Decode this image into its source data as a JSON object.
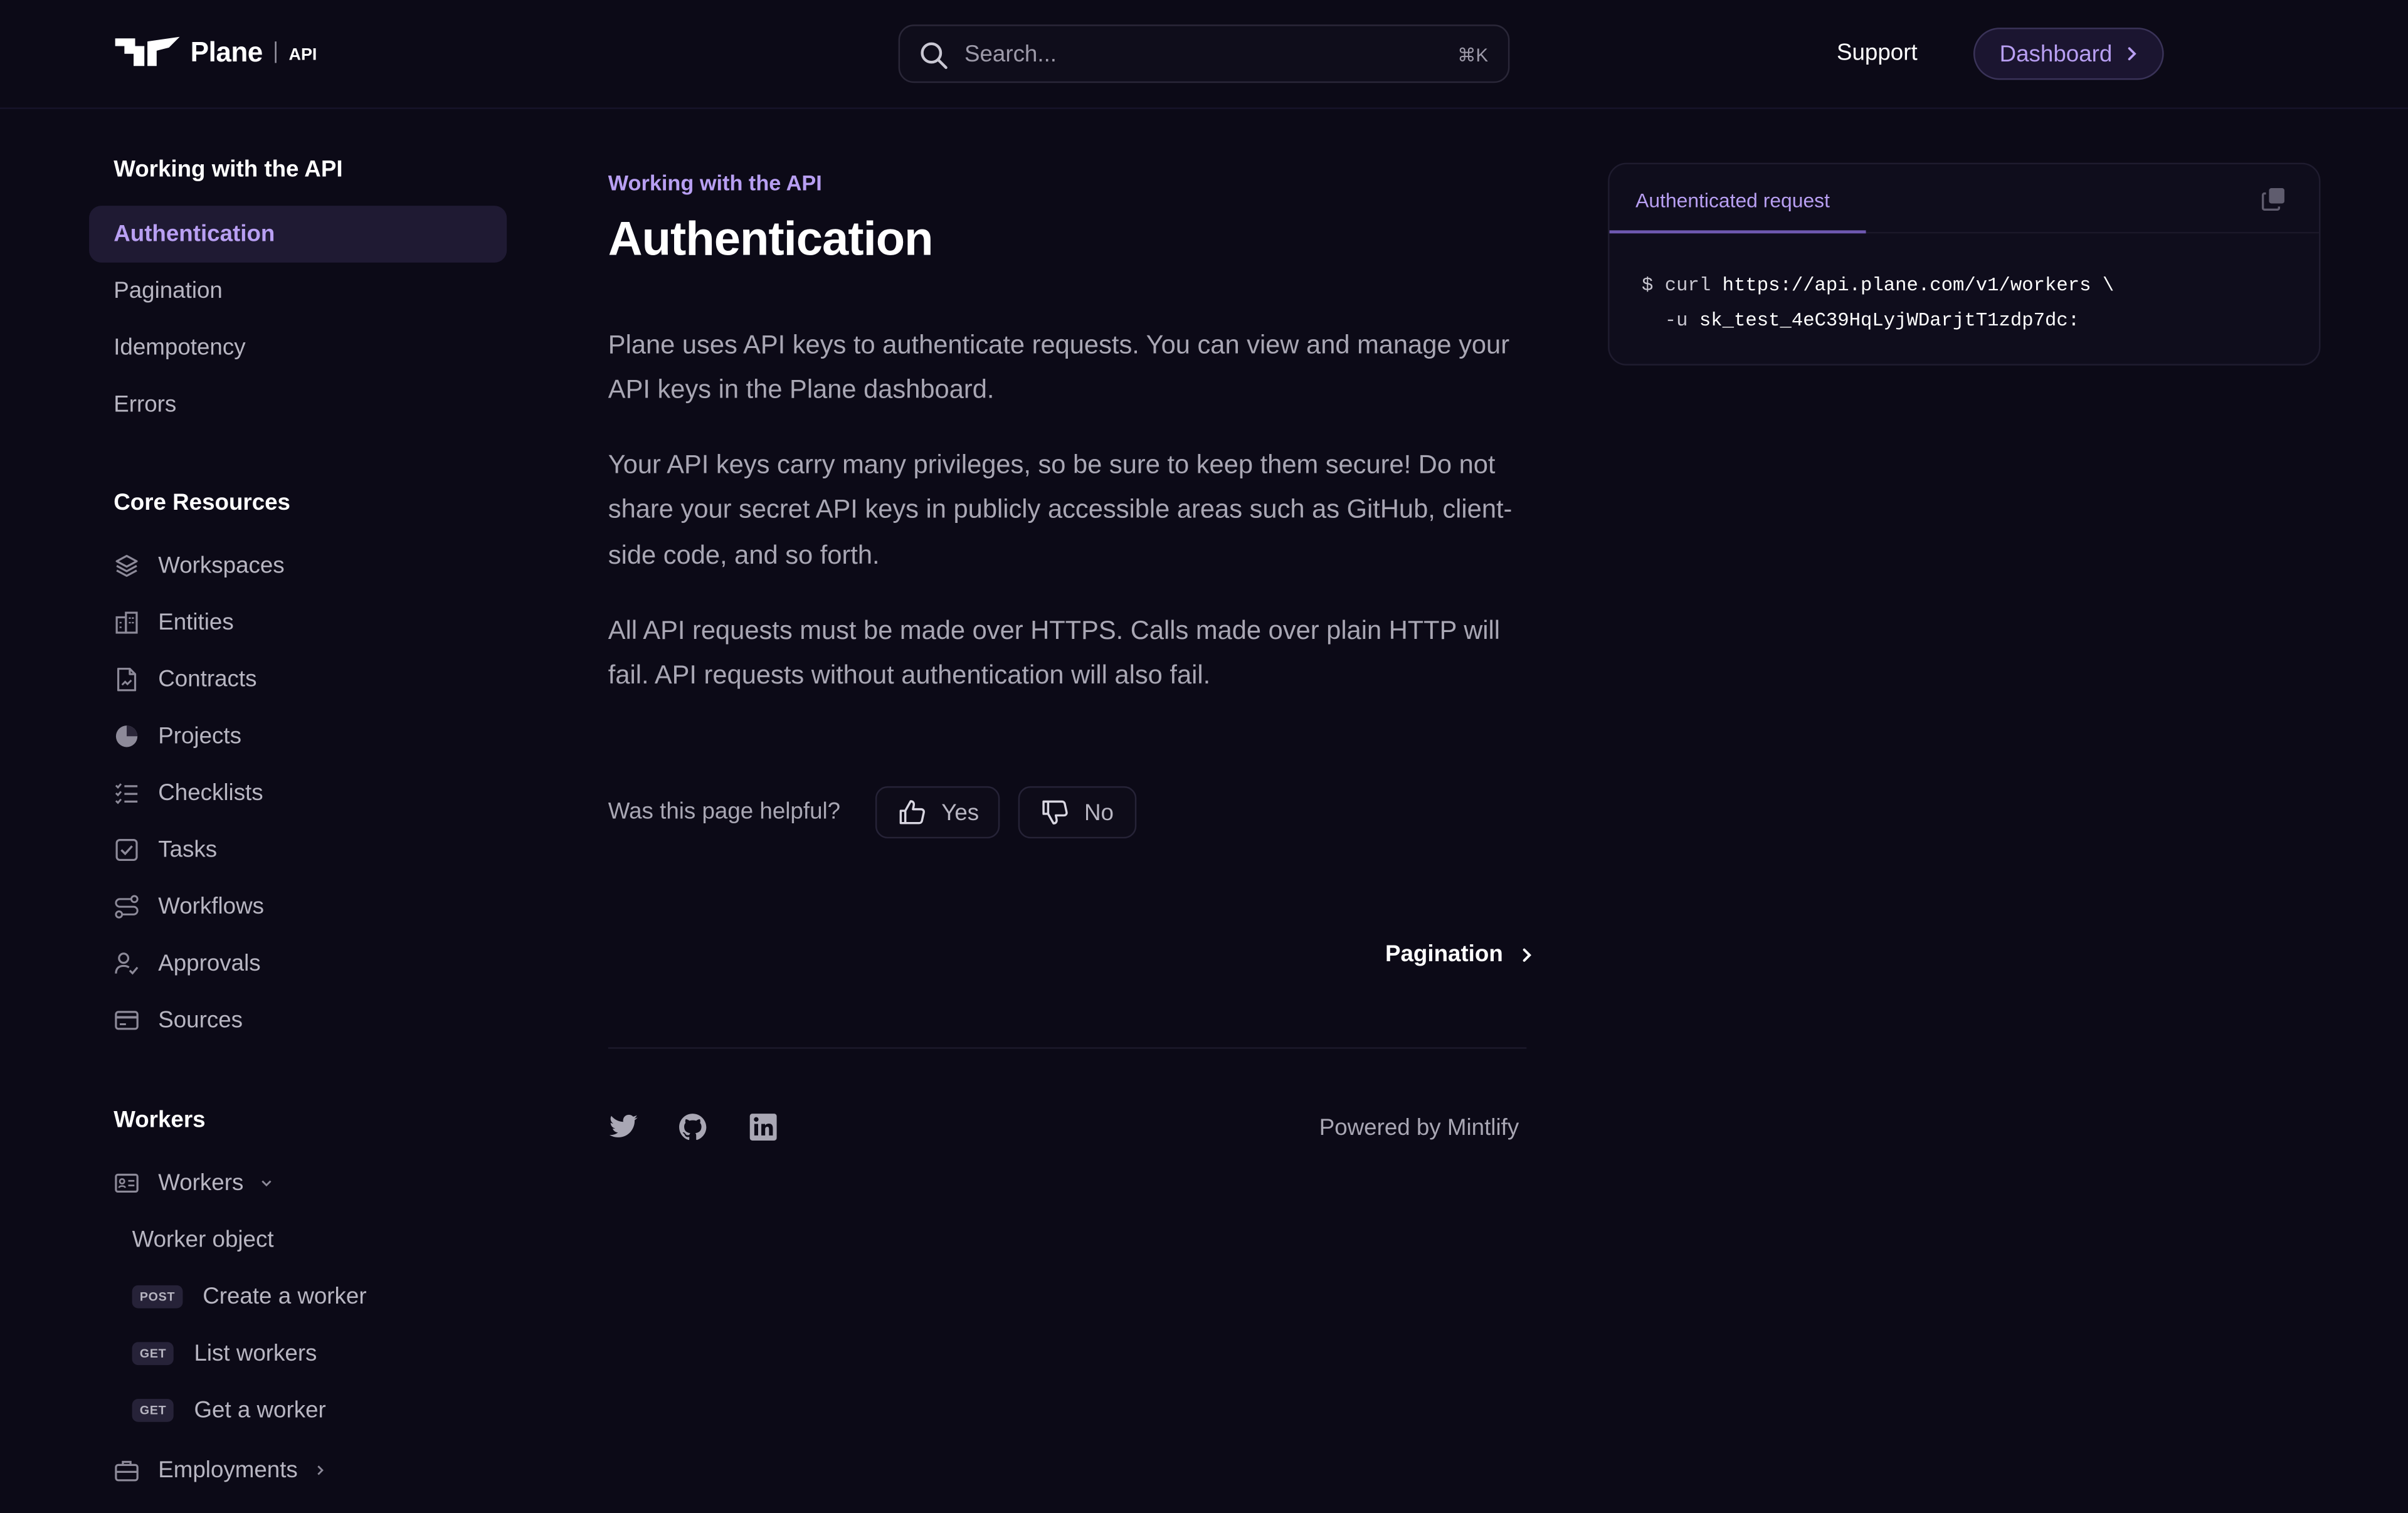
{
  "header": {
    "logo_text": "Plane",
    "logo_sub": "API",
    "search_placeholder": "Search...",
    "search_shortcut": "⌘K",
    "support_label": "Support",
    "dashboard_label": "Dashboard"
  },
  "sidebar": {
    "section1_title": "Working with the API",
    "section1_items": [
      "Authentication",
      "Pagination",
      "Idempotency",
      "Errors"
    ],
    "section2_title": "Core Resources",
    "section2_items": [
      {
        "label": "Workspaces",
        "icon": "layers-icon"
      },
      {
        "label": "Entities",
        "icon": "building-icon"
      },
      {
        "label": "Contracts",
        "icon": "document-icon"
      },
      {
        "label": "Projects",
        "icon": "pie-icon"
      },
      {
        "label": "Checklists",
        "icon": "checklist-icon"
      },
      {
        "label": "Tasks",
        "icon": "checkbox-icon"
      },
      {
        "label": "Workflows",
        "icon": "workflow-icon"
      },
      {
        "label": "Approvals",
        "icon": "user-check-icon"
      },
      {
        "label": "Sources",
        "icon": "card-icon"
      }
    ],
    "section3_title": "Workers",
    "workers_label": "Workers",
    "worker_object": "Worker object",
    "endpoints": [
      {
        "method": "POST",
        "label": "Create a worker"
      },
      {
        "method": "GET",
        "label": "List workers"
      },
      {
        "method": "GET",
        "label": "Get a worker"
      }
    ],
    "employments_label": "Employments"
  },
  "main": {
    "breadcrumb": "Working with the API",
    "title": "Authentication",
    "paragraphs": [
      "Plane uses API keys to authenticate requests. You can view and manage your API keys in the Plane dashboard.",
      "Your API keys carry many privileges, so be sure to keep them secure! Do not share your secret API keys in publicly accessible areas such as GitHub, client-side code, and so forth.",
      "All API requests must be made over HTTPS. Calls made over plain HTTP will fail. API requests without authentication will also fail."
    ],
    "helpful_question": "Was this page helpful?",
    "yes_label": "Yes",
    "no_label": "No",
    "next_label": "Pagination",
    "powered_by": "Powered by Mintlify"
  },
  "code_panel": {
    "tab_label": "Authenticated request",
    "line1_prefix": "$ curl",
    "line1_rest": " https://api.plane.com/v1/workers \\",
    "line2_prefix": "  -u",
    "line2_rest": " sk_test_4eC39HqLyjWDarjtT1zdp7dc:"
  },
  "colors": {
    "background": "#0c0a17",
    "accent": "#b89ff2",
    "active_bg": "#1f1a33"
  }
}
